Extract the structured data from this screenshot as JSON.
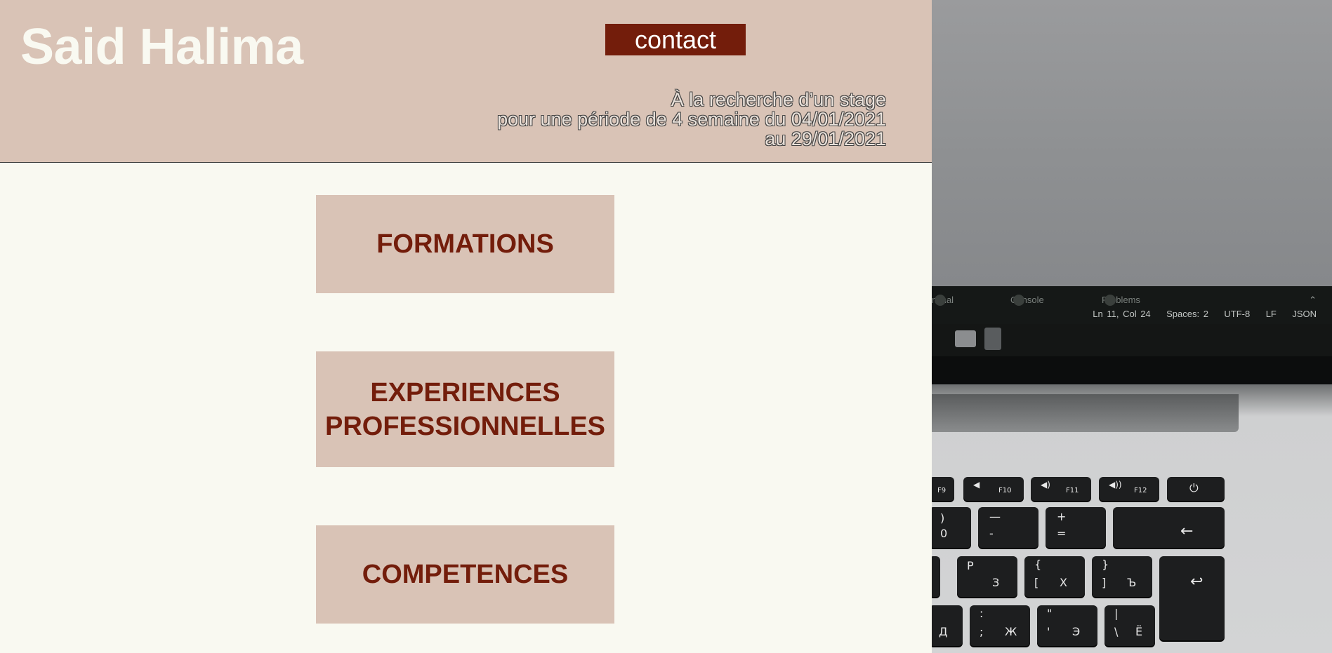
{
  "header": {
    "title": "Said Halima",
    "contact_label": "contact",
    "tagline": [
      "À la recherche d’un stage",
      "pour une période de 4 semaine du 04/01/2021",
      "au 29/01/2021"
    ]
  },
  "sections": [
    {
      "label": "FORMATIONS"
    },
    {
      "label_lines": [
        "EXPERIENCES",
        "PROFESSIONNELLES"
      ]
    },
    {
      "label": "COMPETENCES"
    }
  ],
  "photo": {
    "editor_tabs": [
      "minal",
      "Console",
      "Problems"
    ],
    "status": [
      "Ln 11, Col 24",
      "Spaces: 2",
      "UTF-8",
      "LF",
      "JSON"
    ],
    "keys": {
      "f9": "F9",
      "f10": "F10",
      "f11": "F11",
      "f12": "F12",
      "k0_top": ")",
      "k0_bot": "0",
      "minus_top": "—",
      "minus_bot": "-",
      "plus_top": "+",
      "plus_bot": "=",
      "back": "←",
      "r_p": "Р",
      "r_z": "З",
      "brace_l_top": "{",
      "brace_l_mid": "[",
      "brace_l_bot": "Х",
      "brace_r_top": "}",
      "brace_r_mid": "]",
      "brace_r_bot": "Ъ",
      "enter": "↩",
      "colon_top": ":",
      "colon_bot": ";",
      "zh": "Ж",
      "quote_top": "\"",
      "quote_bot": "'",
      "e": "Э",
      "pipe_top": "|",
      "pipe_bot": "\\",
      "yo": "Ё",
      "d": "Д"
    }
  },
  "colors": {
    "header_bg": "#d9c3b6",
    "accent": "#731d0b",
    "page_bg": "#f9f9f1"
  }
}
